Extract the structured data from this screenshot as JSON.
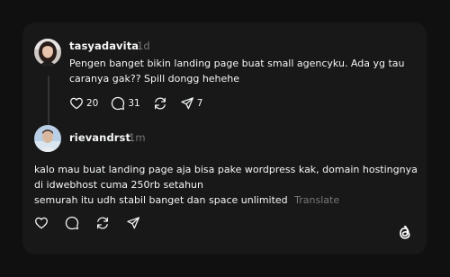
{
  "post": {
    "username": "tasyadavita",
    "time": "1d",
    "lines": [
      "Pengen banget bikin landing page buat small agencyku. Ada yg tau",
      "caranya gak?? Spill dongg hehehe"
    ],
    "likes": "20",
    "comments": "31",
    "shares": "7"
  },
  "reply": {
    "username": "rievandrst",
    "time": "1m",
    "lines": [
      "kalo mau buat landing page aja bisa pake wordpress kak, domain hostingnya",
      "di idwebhost cuma 250rb setahun",
      "semurah itu udh stabil banget dan space unlimited"
    ],
    "translate_label": "Translate"
  },
  "icons": {
    "like": "heart-icon",
    "comment": "comment-icon",
    "repost": "repost-icon",
    "share": "send-icon",
    "brand": "threads-logo"
  },
  "colors": {
    "page_bg": "#101010",
    "card_bg": "#181818",
    "text": "#f3f5f7",
    "muted": "#777777"
  }
}
